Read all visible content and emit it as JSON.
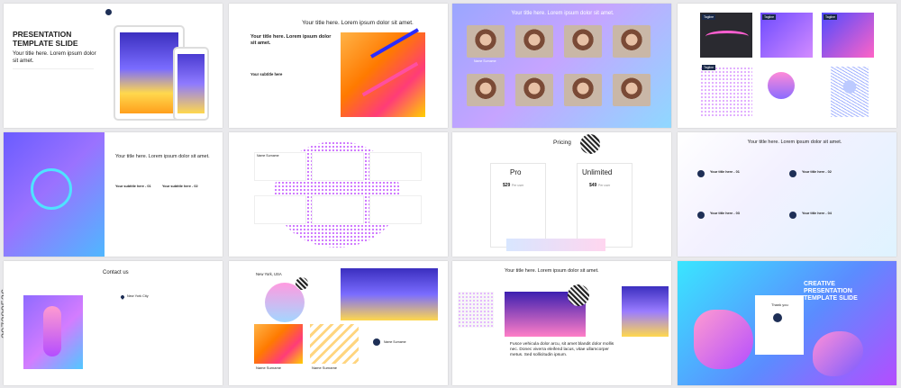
{
  "slide1": {
    "title": "PRESENTATION\nTEMPLATE SLIDE",
    "subtitle": "Your title here. Lorem ipsum dolor sit amet."
  },
  "slide2": {
    "title": "Your title here. Lorem ipsum dolor sit amet.",
    "heading": "Your title here. Lorem ipsum dolor sit amet.",
    "subtitle_label": "Your subtitle here"
  },
  "slide3": {
    "title": "Your title here. Lorem ipsum dolor sit amet.",
    "name_label": "Name Surname"
  },
  "slide4": {
    "tagline_label": "Tagline"
  },
  "slide5": {
    "title": "Your title here. Lorem ipsum dolor sit amet.",
    "sub1": "Your subtitle here - 01",
    "sub2": "Your subtitle here - 02"
  },
  "slide6": {
    "name_label": "Name Surname"
  },
  "slide7": {
    "title": "Pricing",
    "plans": [
      {
        "name": "Pro",
        "price": "$29",
        "unit": "Per user"
      },
      {
        "name": "Unlimited",
        "price": "$49",
        "unit": "Per user"
      }
    ]
  },
  "slide8": {
    "title": "Your title here. Lorem ipsum dolor sit amet.",
    "items": [
      "Your title here - 01",
      "Your title here - 02",
      "Your title here - 03",
      "Your title here - 04"
    ]
  },
  "slide9": {
    "title": "Contact us",
    "location": "New York City"
  },
  "slide10": {
    "location": "New York, USA",
    "name1": "Name Surname",
    "name2": "Name Surname",
    "name3": "Name Surname"
  },
  "slide11": {
    "title": "Your title here. Lorem ipsum dolor sit amet.",
    "body": "Fusce vehicula dolor arcu, sit amet blandit dolor mollis nec. Donec viverra eleifend lacus, vitae ullamcorper metus. Sed sollicitudin ipsum."
  },
  "slide12": {
    "title": "CREATIVE\nPRESENTATION\nTEMPLATE SLIDE",
    "thank_you": "Thank you"
  },
  "side_id": "207389536",
  "colors": {
    "navy": "#1e2f56",
    "purple": "#a96cff",
    "cyan": "#39e6ff",
    "orange": "#ff7a00"
  }
}
